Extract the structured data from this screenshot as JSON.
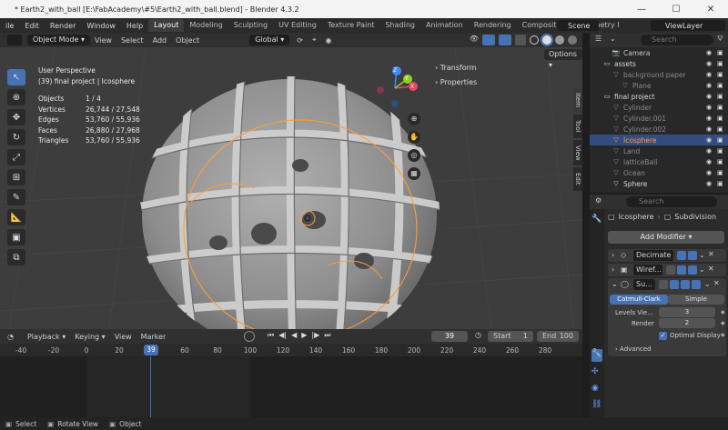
{
  "window": {
    "title": "* Earth2_with_ball [E:\\FabAcademy\\#5\\Earth2_with_ball.blend] - Blender 4.3.2",
    "minimize": "—",
    "maximize": "☐",
    "close": "✕"
  },
  "menubar": {
    "items": [
      "ile",
      "Edit",
      "Render",
      "Window",
      "Help"
    ],
    "workspaces": [
      "Layout",
      "Modeling",
      "Sculpting",
      "UV Editing",
      "Texture Paint",
      "Shading",
      "Animation",
      "Rendering",
      "Compositing",
      "Geometry Node"
    ],
    "active_workspace": "Layout",
    "scene": "Scene",
    "view_layer": "ViewLayer"
  },
  "viewport_header": {
    "mode": "Object Mode",
    "menus": [
      "View",
      "Select",
      "Add",
      "Object"
    ],
    "transform_orientation": "Global",
    "options": "Options"
  },
  "viewport": {
    "perspective": "User Perspective",
    "context": "(39) final project | Icosphere",
    "stats": [
      {
        "key": "Objects",
        "value": "1 / 4"
      },
      {
        "key": "Vertices",
        "value": "26,744 / 27,548"
      },
      {
        "key": "Edges",
        "value": "53,760 / 55,936"
      },
      {
        "key": "Faces",
        "value": "26,880 / 27,968"
      },
      {
        "key": "Triangles",
        "value": "53,760 / 55,936"
      }
    ],
    "panels": [
      "Transform",
      "Properties"
    ],
    "npanel_tabs": [
      "Item",
      "Tool",
      "View",
      "Edit"
    ],
    "gizmo": {
      "x": "X",
      "y": "Y",
      "z": "Z"
    }
  },
  "timeline": {
    "menus": [
      "Playback",
      "Keying",
      "View",
      "Marker"
    ],
    "current_frame": "39",
    "start_label": "Start",
    "start": "1",
    "end_label": "End",
    "end": "100",
    "ruler": [
      "-40",
      "-20",
      "0",
      "20",
      "40",
      "60",
      "80",
      "100",
      "120",
      "140",
      "160",
      "180",
      "200",
      "220",
      "240",
      "260",
      "280"
    ],
    "ruler_current": "39"
  },
  "statusbar": {
    "items": [
      "Select",
      "Rotate View",
      "Object"
    ]
  },
  "outliner": {
    "search_placeholder": "Search",
    "rows": [
      {
        "name": "Camera",
        "indent": 2,
        "icon": "camera-icon",
        "color": "#c8c8c8"
      },
      {
        "name": "assets",
        "indent": 1,
        "icon": "collection-icon",
        "color": "#d8d8d8"
      },
      {
        "name": "background paper",
        "indent": 2,
        "icon": "mesh-icon",
        "color": "#8a8a8a"
      },
      {
        "name": "Plane",
        "indent": 3,
        "icon": "mesh-icon",
        "color": "#8a8a8a"
      },
      {
        "name": "final project",
        "indent": 1,
        "icon": "collection-icon",
        "color": "#d8d8d8"
      },
      {
        "name": "Cylinder",
        "indent": 2,
        "icon": "mesh-icon",
        "color": "#8a8a8a"
      },
      {
        "name": "Cylinder.001",
        "indent": 2,
        "icon": "mesh-icon",
        "color": "#8a8a8a"
      },
      {
        "name": "Cylinder.002",
        "indent": 2,
        "icon": "mesh-icon",
        "color": "#8a8a8a"
      },
      {
        "name": "Icosphere",
        "indent": 2,
        "icon": "mesh-icon",
        "color": "#ff9c3a",
        "selected": true
      },
      {
        "name": "Land",
        "indent": 2,
        "icon": "mesh-icon",
        "color": "#8a8a8a"
      },
      {
        "name": "latticeBall",
        "indent": 2,
        "icon": "mesh-icon",
        "color": "#8a8a8a"
      },
      {
        "name": "Ocean",
        "indent": 2,
        "icon": "mesh-icon",
        "color": "#8a8a8a"
      },
      {
        "name": "Sphere",
        "indent": 2,
        "icon": "mesh-icon",
        "color": "#d8d8d8"
      }
    ]
  },
  "properties": {
    "search_placeholder": "Search",
    "object_name": "Icosphere",
    "modifier_context": "Subdivision",
    "add_modifier": "Add Modifier",
    "modifiers": [
      {
        "name": "Decimate"
      },
      {
        "name": "Wiref..."
      },
      {
        "name": "Su..."
      }
    ],
    "subdivision": {
      "tab_catmull": "Catmull-Clark",
      "tab_simple": "Simple",
      "levels_label": "Levels Vie...",
      "levels_value": "3",
      "render_label": "Render",
      "render_value": "2",
      "optimal_display": "Optimal Display",
      "advanced": "Advanced"
    }
  },
  "colors": {
    "accent": "#4772b3",
    "selection_orange": "#ff9c3a",
    "axis_x": "#e8485f",
    "axis_y": "#8ecf2b",
    "axis_z": "#3f8cff"
  }
}
